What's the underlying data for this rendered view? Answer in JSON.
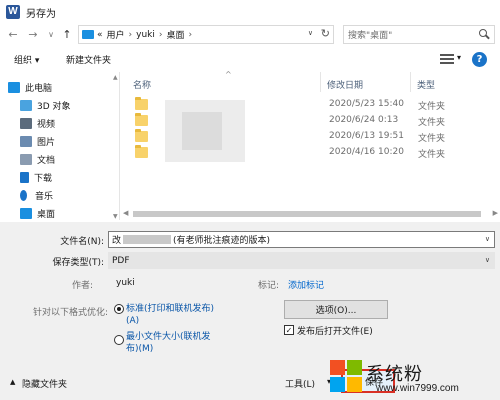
{
  "window": {
    "app_icon_letter": "W",
    "title": "另存为"
  },
  "address": {
    "nav_back": "←",
    "nav_forward": "→",
    "nav_recent": "∨",
    "nav_up": "↑",
    "overflow": "«",
    "crumbs": [
      "用户",
      "yuki",
      "桌面"
    ],
    "dropdown": "∨",
    "refresh": "↻",
    "search_placeholder": "搜索\"桌面\""
  },
  "toolbar": {
    "organize": "组织 ▾",
    "new_folder": "新建文件夹",
    "view_dropdown": "▾",
    "help": "?"
  },
  "nav": {
    "items": [
      {
        "label": "此电脑",
        "icon": "computer-icon",
        "color": "#1a8fe0"
      },
      {
        "label": "3D 对象",
        "icon": "3d-objects-icon",
        "color": "#4aa3df"
      },
      {
        "label": "视频",
        "icon": "videos-icon",
        "color": "#5b6b7c"
      },
      {
        "label": "图片",
        "icon": "pictures-icon",
        "color": "#6b8bb0"
      },
      {
        "label": "文档",
        "icon": "documents-icon",
        "color": "#8a9bb0"
      },
      {
        "label": "下载",
        "icon": "downloads-icon",
        "color": "#1a73c8"
      },
      {
        "label": "音乐",
        "icon": "music-icon",
        "color": "#1a73c8"
      },
      {
        "label": "桌面",
        "icon": "desktop-icon",
        "color": "#1a8fe0"
      }
    ]
  },
  "files": {
    "columns": {
      "name": "名称",
      "date": "修改日期",
      "type": "类型"
    },
    "sort_indicator": "^",
    "rows": [
      {
        "name": "",
        "date": "2020/5/23 15:40",
        "type": "文件夹"
      },
      {
        "name": "",
        "date": "2020/6/24 0:13",
        "type": "文件夹"
      },
      {
        "name": "",
        "date": "2020/6/13 19:51",
        "type": "文件夹"
      },
      {
        "name": "",
        "date": "2020/4/16 10:20",
        "type": "文件夹"
      }
    ]
  },
  "form": {
    "filename_label": "文件名(N):",
    "filename_prefix": "改",
    "filename_suffix": "(有老师批注痕迹的版本)",
    "filetype_label": "保存类型(T):",
    "filetype_value": "PDF",
    "author_label": "作者:",
    "author_value": "yuki",
    "tags_label": "标记:",
    "tags_value": "添加标记",
    "optimize_label": "针对以下格式优化:",
    "opt_standard": "标准(打印和联机发布)",
    "opt_standard_key": "(A)",
    "opt_min": "最小文件大小(联机发",
    "opt_min_2": "布)(M)",
    "options_button": "选项(O)...",
    "open_after_label": "发布后打开文件(E)",
    "open_after_checked": true,
    "hide_folders": "隐藏文件夹",
    "tools": "工具(L)",
    "tools_dd": "▾",
    "save": "保存"
  },
  "watermark": {
    "text": "系统粉",
    "url": "www.win7999.com"
  }
}
